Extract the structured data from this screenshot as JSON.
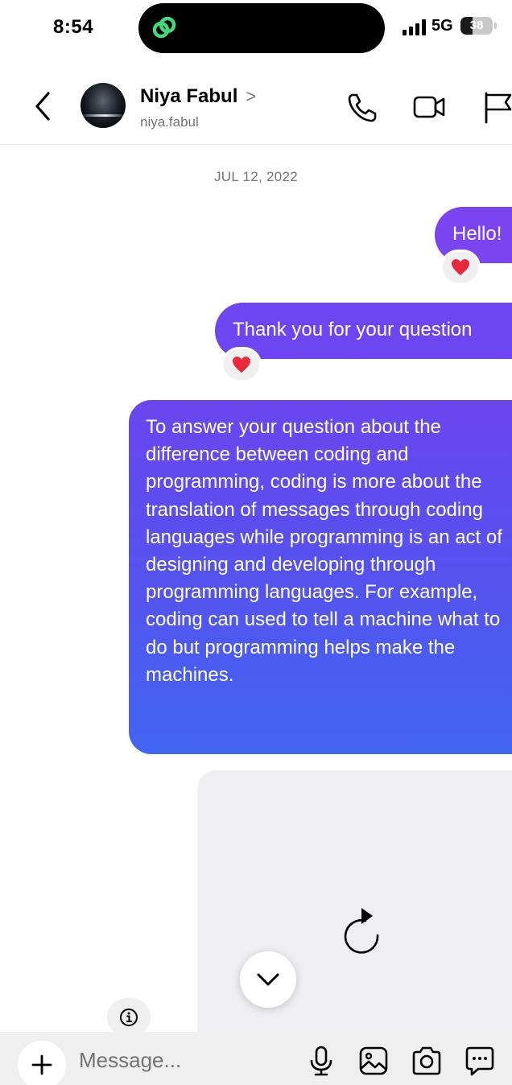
{
  "status_bar": {
    "time": "8:54",
    "network": "5G",
    "battery": "38",
    "battery_level": 0.38,
    "island_app_icon": "link-loop-icon",
    "island_app_color": "#43d97a"
  },
  "header": {
    "back_icon": "chevron-left-icon",
    "contact_name": "Niya Fabul",
    "name_chevron": ">",
    "username": "niya.fabul",
    "actions": [
      "phone-icon",
      "video-camera-icon",
      "flag-icon"
    ]
  },
  "chat": {
    "date": "JUL 12, 2022",
    "messages": [
      {
        "text": "Hello!",
        "reaction": "❤️"
      },
      {
        "text": "Thank you for your question",
        "reaction": "❤️"
      },
      {
        "text": "To answer your question about the difference between coding and programming, coding is more about the translation of messages through coding languages while programming is an act of designing and developing through programming languages. For example, coding can used to tell a machine what to do but programming helps make the machines."
      }
    ],
    "media_placeholder_icon": "reload-icon",
    "scroll_down_icon": "chevron-down-icon",
    "info_icon": "info-icon"
  },
  "composer": {
    "placeholder": "Message...",
    "value": "",
    "add_icon": "plus-icon",
    "icons": [
      "microphone-icon",
      "image-icon",
      "camera-icon",
      "sticker-icon"
    ]
  },
  "colors": {
    "bubble_start": "#7b44f1",
    "bubble_end": "#4266f1",
    "heart": "#e8283c"
  }
}
